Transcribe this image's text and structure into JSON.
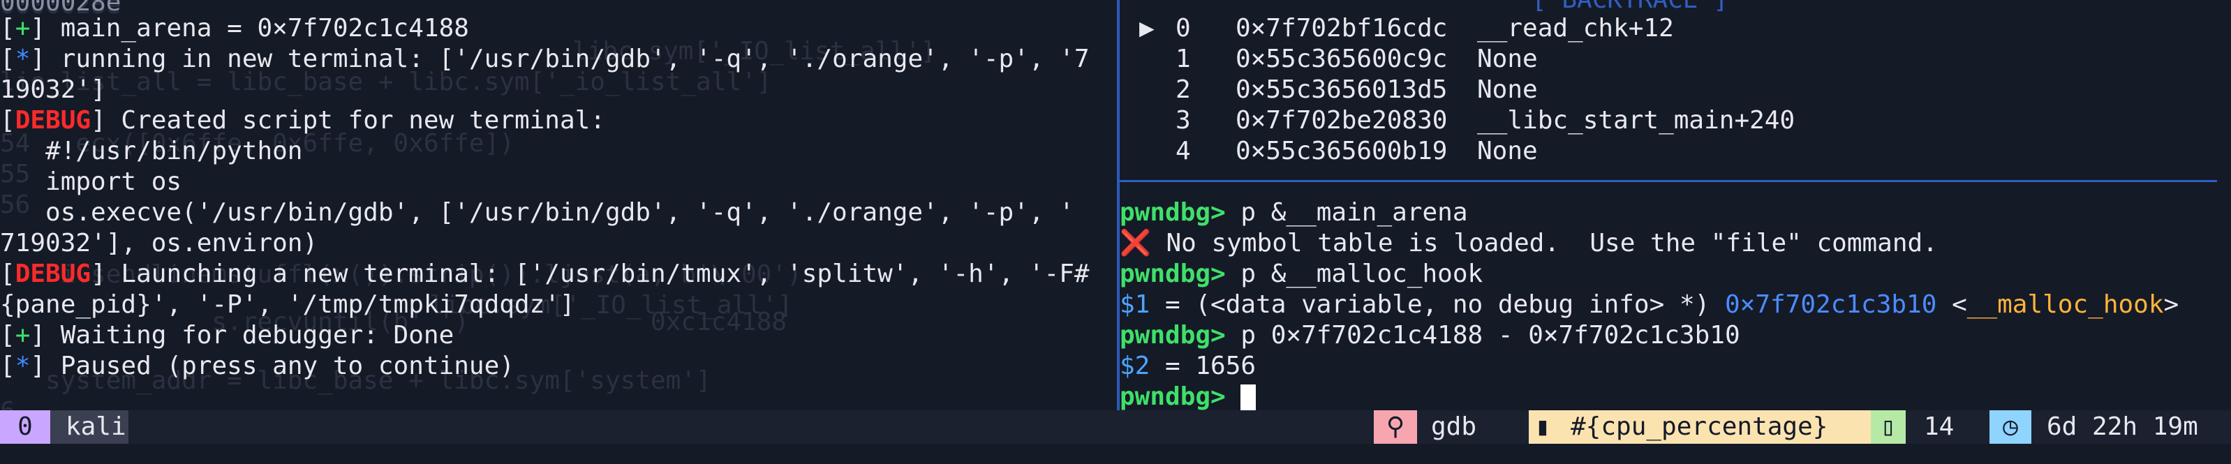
{
  "left_pane": {
    "ghost_lines": [
      "0000028e",
      "            libc.sym['_IO_list_all']",
      "lio_list_all = libc_base + libc.sym['_io_list_all']",
      "54   ecx([0x6ffe, 0x6ffe, 0x6ffe])",
      "55",
      "56",
      "    i.sendlinemstuffl(x()).strip()).ljust(a, b'\\x00')",
      "         libc.sym['_IO_list_all']",
      "              s.recvuntil(b' ')            0xc1c4188",
      "   system_addr = libc_base + libc.sym['system']",
      "6"
    ],
    "lines": [
      {
        "tag": "",
        "text": "0000028e"
      },
      {
        "tag": "+",
        "text": " main_arena = 0×7f702c1c4188"
      },
      {
        "tag": "*",
        "text": " running in new terminal: ['/usr/bin/gdb', '-q', './orange', '-p', '7"
      },
      {
        "tag": "",
        "text": "19032']"
      },
      {
        "tag": "DEBUG",
        "text": " Created script for new terminal:"
      },
      {
        "tag": "",
        "text": "   #!/usr/bin/python"
      },
      {
        "tag": "",
        "text": "   import os"
      },
      {
        "tag": "",
        "text": "   os.execve('/usr/bin/gdb', ['/usr/bin/gdb', '-q', './orange', '-p', '"
      },
      {
        "tag": "",
        "text": "719032'], os.environ)"
      },
      {
        "tag": "DEBUG",
        "text": " Launching a new terminal: ['/usr/bin/tmux', 'splitw', '-h', '-F#"
      },
      {
        "tag": "",
        "text": "{pane_pid}', '-P', '/tmp/tmpki7qdqdz']"
      },
      {
        "tag": "+",
        "text": " Waiting for debugger: Done"
      },
      {
        "tag": "*",
        "text": " Paused (press any to continue)"
      }
    ]
  },
  "right_pane": {
    "backtrace_header": "[ BACKTRACE ]",
    "backtrace": [
      {
        "marker": "▶",
        "index": "0",
        "addr": "0×7f702bf16cdc",
        "symbol": "__read_chk+12"
      },
      {
        "marker": "",
        "index": "1",
        "addr": "0×55c365600c9c",
        "symbol": "None"
      },
      {
        "marker": "",
        "index": "2",
        "addr": "0×55c3656013d5",
        "symbol": "None"
      },
      {
        "marker": "",
        "index": "3",
        "addr": "0×7f702be20830",
        "symbol": "__libc_start_main+240"
      },
      {
        "marker": "",
        "index": "4",
        "addr": "0×55c365600b19",
        "symbol": "None"
      }
    ],
    "prompt": "pwndbg>",
    "session": {
      "cmd1": " p &__main_arena",
      "err_icon": "❌",
      "err_text": " No symbol table is loaded.  Use the \"file\" command.",
      "cmd2": " p &__malloc_hook",
      "res1_var": "$1",
      "res1_mid": " = (<data variable, no debug info> *) ",
      "res1_addr": "0×7f702c1c3b10",
      "res1_lt": " <",
      "res1_sym": "__malloc_hook",
      "res1_gt": ">",
      "cmd3": " p 0×7f702c1c4188 - 0×7f702c1c3b10",
      "res2_var": "$2",
      "res2_rest": " = 1656"
    }
  },
  "status_bar": {
    "session_index": "0",
    "session_name": "kali",
    "window_name": "gdb",
    "cpu_text": "#{cpu_percentage}",
    "count": "14",
    "uptime": "6d 22h 19m"
  },
  "colors": {
    "background": "#151a27",
    "divider": "#2c5bb8",
    "accent_purple": "#c9a6ff",
    "accent_pink": "#f7a6b0",
    "accent_yellow": "#fbe3b0",
    "accent_green": "#b7e9a6",
    "accent_cyan": "#8fd3ff"
  }
}
